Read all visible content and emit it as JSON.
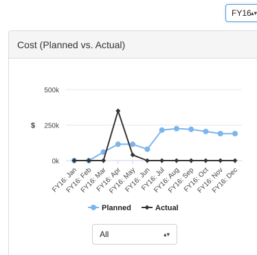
{
  "period_select": {
    "value": "FY16",
    "arrows": "▴▾"
  },
  "panel": {
    "title": "Cost (Planned vs. Actual)"
  },
  "filter_select": {
    "value": "All",
    "arrows": "▴▾"
  },
  "colors": {
    "planned": "#7cb5ec",
    "actual": "#333333",
    "grid": "#e6e6e6",
    "axis": "#ccd6eb"
  },
  "chart_data": {
    "type": "line",
    "title": "",
    "xlabel": "",
    "ylabel": "$",
    "ylim": [
      0,
      500000
    ],
    "yticks": [
      {
        "value": 0,
        "label": "0k"
      },
      {
        "value": 250000,
        "label": "250k"
      },
      {
        "value": 500000,
        "label": "500k"
      }
    ],
    "categories": [
      "FY16: Jan",
      "FY16: Feb",
      "FY16: Mar",
      "FY16: Apr",
      "FY16: May",
      "FY16: Jun",
      "FY16: Jul",
      "FY16: Aug",
      "FY16: Sep",
      "FY16: Oct",
      "FY16: Nov",
      "FY16: Dec"
    ],
    "series": [
      {
        "name": "Planned",
        "marker": "circle",
        "values": [
          0,
          0,
          60000,
          115000,
          115000,
          80000,
          215000,
          225000,
          220000,
          205000,
          190000,
          190000
        ]
      },
      {
        "name": "Actual",
        "marker": "diamond",
        "values": [
          0,
          0,
          0,
          350000,
          40000,
          0,
          0,
          0,
          0,
          0,
          0,
          0
        ]
      }
    ],
    "legend": "bottom"
  }
}
